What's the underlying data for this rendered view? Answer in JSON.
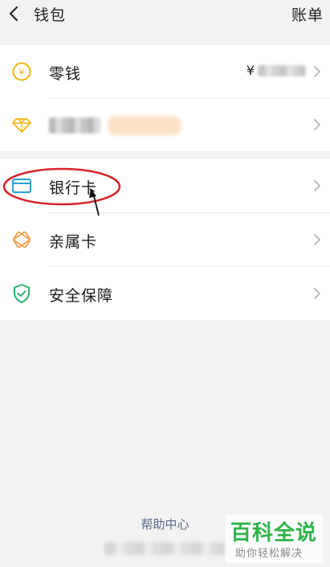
{
  "header": {
    "back_icon": "chevron-left-icon",
    "title": "钱包",
    "bills": "账单"
  },
  "card1": {
    "change": {
      "icon": "yen-coin-icon",
      "label": "零钱",
      "currency": "¥",
      "value_obscured": true
    },
    "member": {
      "icon": "diamond-icon",
      "label_obscured": true
    }
  },
  "card2": {
    "bank_card": {
      "icon": "bank-card-icon",
      "label": "银行卡"
    },
    "family_card": {
      "icon": "family-card-icon",
      "label": "亲属卡"
    },
    "security": {
      "icon": "shield-check-icon",
      "label": "安全保障"
    }
  },
  "footer": {
    "help": "帮助中心",
    "obscured_line": true
  },
  "watermark": {
    "big": "百科全说",
    "small": "助你轻松解决"
  },
  "colors": {
    "background": "#f2f2f2",
    "card": "#ffffff",
    "yellow_icon": "#f1b50c",
    "blue_icon": "#2aa0d8",
    "orange_icon": "#f0a04b",
    "green_icon": "#28b36b",
    "annotation_red": "#d8232a",
    "link": "#5b6b8c",
    "watermark_green": "#2fb34a"
  }
}
